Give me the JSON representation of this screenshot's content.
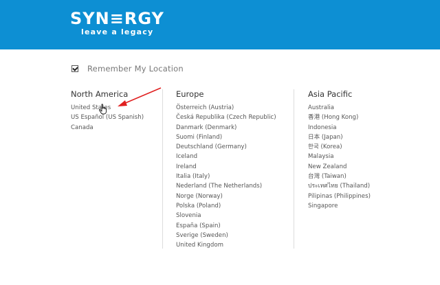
{
  "header": {
    "logo_text": "SYN≡RGY",
    "tagline": "leave a legacy",
    "colors": {
      "background": "#0d8fd3",
      "logo": "#ffffff"
    }
  },
  "remember": {
    "label": "Remember My Location",
    "checked": true
  },
  "regions": {
    "north_america": {
      "title": "North America",
      "items": [
        "United States",
        "US Español (US Spanish)",
        "Canada"
      ]
    },
    "europe": {
      "title": "Europe",
      "items": [
        "Österreich (Austria)",
        "Česká Republika (Czech Republic)",
        "Danmark (Denmark)",
        "Suomi (Finland)",
        "Deutschland (Germany)",
        "Iceland",
        "Ireland",
        "Italia (Italy)",
        "Nederland (The Netherlands)",
        "Norge (Norway)",
        "Polska (Poland)",
        "Slovenia",
        "España (Spain)",
        "Sverige (Sweden)",
        "United Kingdom"
      ]
    },
    "asia_pacific": {
      "title": "Asia Pacific",
      "items": [
        "Australia",
        "香港 (Hong Kong)",
        "Indonesia",
        "日本 (Japan)",
        "한국 (Korea)",
        "Malaysia",
        "New Zealand",
        "台灣 (Taiwan)",
        "ประเทศไทย (Thailand)",
        "Pilipinas (Philippines)",
        "Singapore"
      ]
    }
  },
  "annotation": {
    "arrow_color": "#e02020",
    "cursor_icon": "hand-pointer-icon"
  }
}
